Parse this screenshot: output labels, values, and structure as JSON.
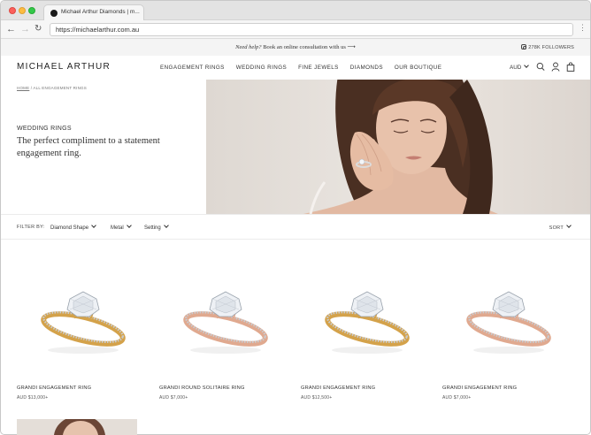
{
  "browser": {
    "tab_title": "Michael Arthur Diamonds | m...",
    "url": "https://michaelarthur.com.au"
  },
  "announcement": {
    "help_emphasis": "Need help?",
    "help_text": " Book an online consultation with us",
    "arrow": "⟶",
    "instagram_followers": "278K FOLLOWERS"
  },
  "header": {
    "logo": "MICHAEL ARTHUR",
    "nav": [
      "ENGAGEMENT RINGS",
      "WEDDING RINGS",
      "FINE JEWELS",
      "DIAMONDS",
      "OUR BOUTIQUE"
    ],
    "currency": "AUD"
  },
  "hero": {
    "breadcrumb_home": "HOME",
    "breadcrumb_rest": " / ALL ENGAGEMENT RINGS",
    "kicker": "WEDDING RINGS",
    "title": "The perfect compliment to a statement engagement ring."
  },
  "filters": {
    "label": "FILTER BY:",
    "items": [
      "Diamond Shape",
      "Metal",
      "Setting"
    ],
    "sort": "SORT"
  },
  "products": [
    {
      "name": "GRANDI ENGAGEMENT RING",
      "price": "AUD $13,000+",
      "metal": "yellow"
    },
    {
      "name": "GRANDI ROUND SOLITAIRE RING",
      "price": "AUD $7,000+",
      "metal": "rose"
    },
    {
      "name": "GRANDI ENGAGEMENT RING",
      "price": "AUD $12,500+",
      "metal": "yellow"
    },
    {
      "name": "GRANDI ENGAGEMENT RING",
      "price": "AUD $7,000+",
      "metal": "rose"
    }
  ],
  "colors": {
    "yellow_gold": "#d4a24a",
    "rose_gold": "#e0a98f",
    "platinum": "#c9ccd1",
    "announcement_bg": "#f4f4f4"
  }
}
